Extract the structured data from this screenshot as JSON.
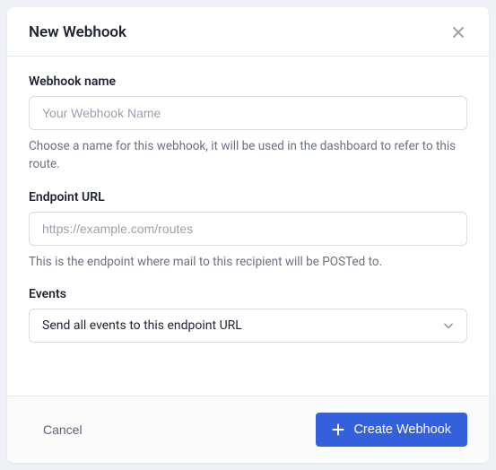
{
  "modal": {
    "title": "New Webhook"
  },
  "form": {
    "name": {
      "label": "Webhook name",
      "placeholder": "Your Webhook Name",
      "help": "Choose a name for this webhook, it will be used in the dashboard to refer to this route."
    },
    "endpoint": {
      "label": "Endpoint URL",
      "placeholder": "https://example.com/routes",
      "help": "This is the endpoint where mail to this recipient will be POSTed to."
    },
    "events": {
      "label": "Events",
      "selected": "Send all events to this endpoint URL"
    }
  },
  "footer": {
    "cancel": "Cancel",
    "submit": "Create Webhook"
  }
}
